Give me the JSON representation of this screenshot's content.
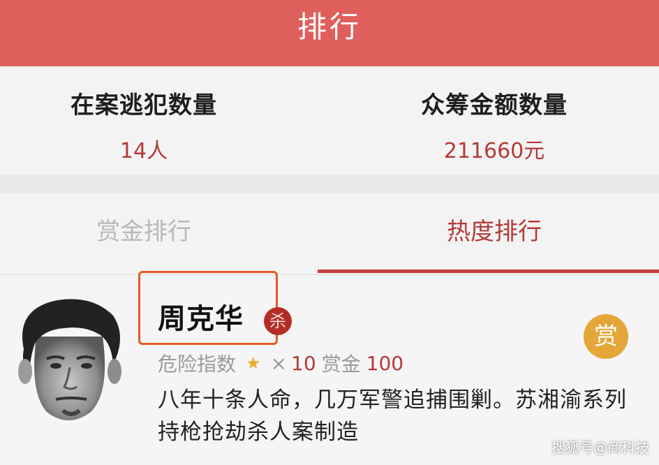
{
  "header": {
    "title": "排行"
  },
  "stats": {
    "fugitives_label": "在案逃犯数量",
    "fugitives_value": "14人",
    "crowdfund_label": "众筹金额数量",
    "crowdfund_value": "211660元"
  },
  "tabs": [
    {
      "label": "赏金排行",
      "active": false
    },
    {
      "label": "热度排行",
      "active": true
    }
  ],
  "item": {
    "name": "周克华",
    "kill_badge": "杀",
    "reward_badge": "赏",
    "danger_label": "危险指数",
    "danger_times": "×",
    "danger_value": "10",
    "bounty_label": "赏金",
    "bounty_value": "100",
    "description": "八年十条人命，几万军警追捕围剿。苏湘渝系列持枪抢劫杀人案制造"
  },
  "watermark": "搜狐号@商科技",
  "colors": {
    "header_bg": "#df5f5c",
    "accent_red": "#b43a36",
    "reward_gold": "#e4a638",
    "highlight_box": "#e25a28"
  },
  "icons": [
    "star-icon",
    "kill-badge-icon",
    "reward-badge-icon",
    "avatar-photo"
  ]
}
